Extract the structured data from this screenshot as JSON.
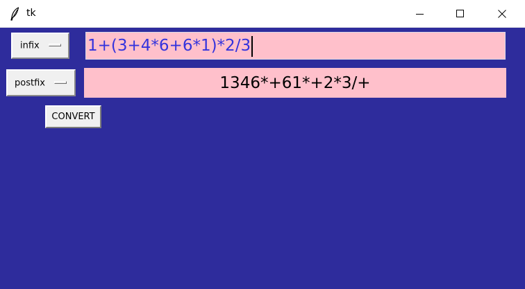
{
  "window": {
    "title": "tk",
    "icon": "feather-icon",
    "background_color": "#2e2c9c"
  },
  "infix": {
    "menu_label": "infix",
    "entry_value": "1+(3+4*6+6*1)*2/3",
    "entry_color": "#3333dd",
    "entry_background": "#ffc0cb"
  },
  "postfix": {
    "menu_label": "postfix",
    "entry_value": "1346*+61*+2*3/+",
    "entry_background": "#ffc0cb"
  },
  "convert": {
    "label": "CONVERT"
  }
}
